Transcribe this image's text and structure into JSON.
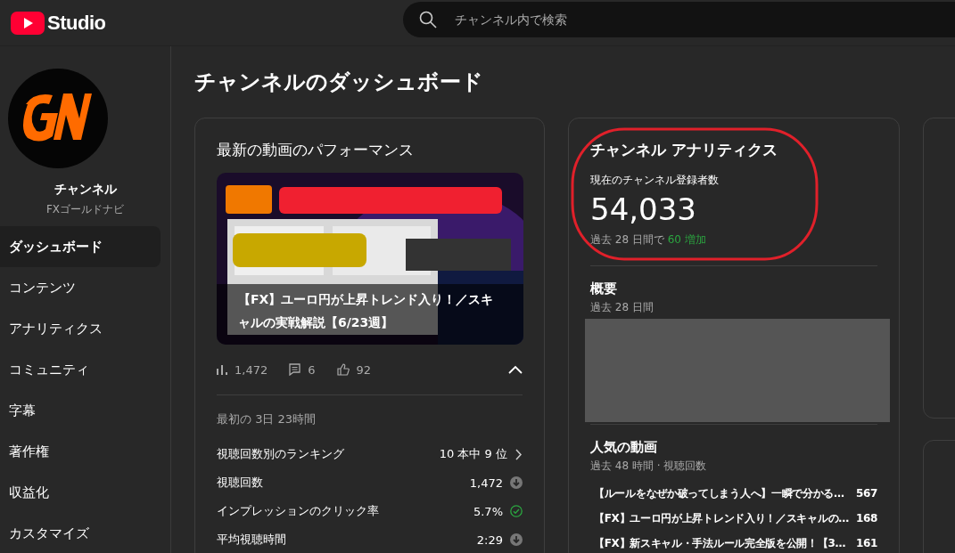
{
  "header": {
    "logo_text": "Studio",
    "search": {
      "placeholder": "チャンネル内で検索"
    }
  },
  "sidebar": {
    "channel": {
      "label": "チャンネル",
      "name": "FXゴールドナビ"
    },
    "items": [
      {
        "label": "ダッシュボード",
        "selected": true
      },
      {
        "label": "コンテンツ",
        "selected": false
      },
      {
        "label": "アナリティクス",
        "selected": false
      },
      {
        "label": "コミュニティ",
        "selected": false
      },
      {
        "label": "字幕",
        "selected": false
      },
      {
        "label": "著作権",
        "selected": false
      },
      {
        "label": "収益化",
        "selected": false
      },
      {
        "label": "カスタマイズ",
        "selected": false
      }
    ]
  },
  "page_title": "チャンネルのダッシュボード",
  "latest_video": {
    "title": "最新の動画のパフォーマンス",
    "thumbnail": {
      "kind": "picture",
      "caption": "【FX】ユーロ円が上昇トレンド入り！／スキャルの実戦解説【6/23週】"
    },
    "stats": [
      {
        "kind": "views",
        "value": "1,472"
      },
      {
        "kind": "comments",
        "value": "6"
      },
      {
        "kind": "likes",
        "value": "92"
      }
    ],
    "expanded": true,
    "period": "最初の 3日 23時間",
    "metrics": [
      {
        "label": "視聴回数別のランキング",
        "value": "10 本中 9 位",
        "kind": "link"
      },
      {
        "label": "視聴回数",
        "value": "1,472",
        "kind": "below"
      },
      {
        "label": "インプレッションのクリック率",
        "value": "5.7%",
        "kind": "above"
      },
      {
        "label": "平均視聴時間",
        "value": "2:29",
        "kind": "below"
      }
    ]
  },
  "channel_analytics": {
    "title": "チャンネル アナリティクス",
    "subscribers_label": "現在のチャンネル登録者数",
    "subscribers": "54,033",
    "change_prefix": "過去 28 日間で",
    "change": "60 増加",
    "summary": {
      "title": "概要",
      "period": "過去 28 日間"
    },
    "top_videos": {
      "title": "人気の動画",
      "period": "過去 48 時間 · 視聴回数",
      "rows": [
        {
          "title": "【ルールをなぜか破ってしまう人へ】一瞬で分かる…",
          "views": "567"
        },
        {
          "title": "【FX】ユーロ円が上昇トレンド入り！／スキャルの…",
          "views": "168"
        },
        {
          "title": "【FX】新スキャル・手法ルール完全版を公開！【3…",
          "views": "161"
        }
      ]
    }
  },
  "annotation": {
    "kind": "ellipse"
  }
}
